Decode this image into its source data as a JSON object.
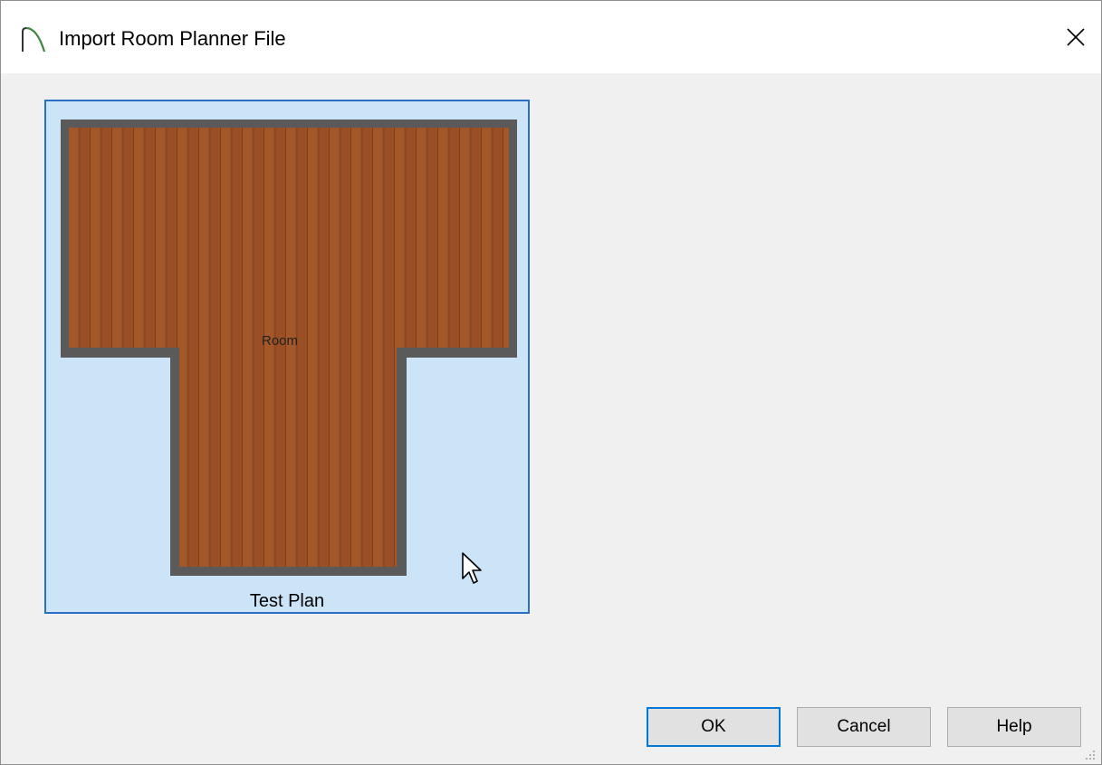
{
  "dialog": {
    "title": "Import Room Planner File",
    "close_icon": "close-icon",
    "app_icon": "arch-icon"
  },
  "plan": {
    "caption": "Test Plan",
    "room_label": "Room",
    "selected": true
  },
  "buttons": {
    "ok": "OK",
    "cancel": "Cancel",
    "help": "Help"
  },
  "colors": {
    "selection_bg": "#cce4f7",
    "selection_border": "#2a6fc4",
    "wall": "#5a5a5a",
    "floor": "#9a4f25",
    "default_button_border": "#0078d7"
  }
}
